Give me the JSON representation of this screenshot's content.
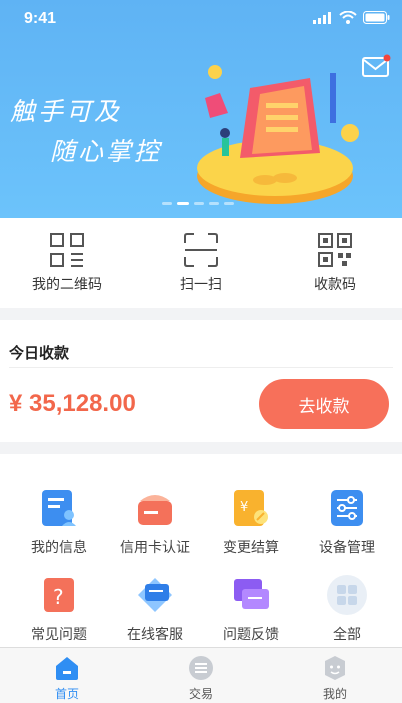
{
  "status_bar": {
    "time": "9:41"
  },
  "banner": {
    "slogan_line1": "触手可及",
    "slogan_line2": "随心掌控",
    "active_dot": 1,
    "dot_count": 5
  },
  "quick_actions": [
    {
      "label": "我的二维码",
      "icon": "qr-code-icon"
    },
    {
      "label": "扫一扫",
      "icon": "scan-icon"
    },
    {
      "label": "收款码",
      "icon": "receive-code-icon"
    }
  ],
  "collection": {
    "title": "今日收款",
    "amount": "¥ 35,128.00",
    "button_label": "去收款"
  },
  "grid": [
    {
      "label": "我的信息",
      "icon": "profile-info-icon"
    },
    {
      "label": "信用卡认证",
      "icon": "credit-card-icon"
    },
    {
      "label": "变更结算",
      "icon": "settlement-icon"
    },
    {
      "label": "设备管理",
      "icon": "device-settings-icon"
    },
    {
      "label": "常见问题",
      "icon": "faq-icon"
    },
    {
      "label": "在线客服",
      "icon": "online-service-icon"
    },
    {
      "label": "问题反馈",
      "icon": "feedback-icon"
    },
    {
      "label": "全部",
      "icon": "all-apps-icon"
    }
  ],
  "tabs": [
    {
      "label": "首页",
      "icon": "home-icon",
      "active": true
    },
    {
      "label": "交易",
      "icon": "transaction-icon",
      "active": false
    },
    {
      "label": "我的",
      "icon": "me-icon",
      "active": false
    }
  ],
  "colors": {
    "accent_blue": "#2f8ef3",
    "amount_red": "#f2674b",
    "button_orange": "#f7705a",
    "banner_blue": "#5fb3f4"
  }
}
